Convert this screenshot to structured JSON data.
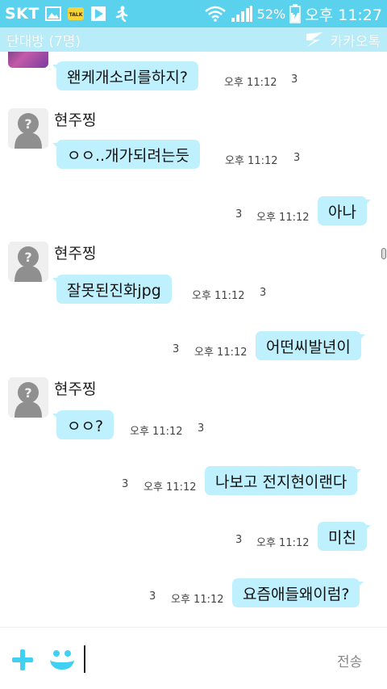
{
  "status_bar": {
    "carrier": "SKT",
    "battery": "52%",
    "time": "오후 11:27",
    "icons": [
      "gallery-icon",
      "kakaotalk-notification-icon",
      "play-store-icon",
      "running-man-icon",
      "wifi-icon",
      "signal-icon",
      "battery-icon"
    ]
  },
  "header": {
    "title": "단대방 (7명)",
    "brand": "카카오톡"
  },
  "messages": [
    {
      "side": "in",
      "sender": "",
      "text": "왠케개소리를하지?",
      "time": "오후 11:12",
      "unread": "3"
    },
    {
      "side": "in",
      "sender": "현주찡",
      "text": "ㅇㅇ..개가되려는듯",
      "time": "오후 11:12",
      "unread": "3"
    },
    {
      "side": "out",
      "text": "아나",
      "time": "오후 11:12",
      "unread": "3"
    },
    {
      "side": "in",
      "sender": "현주찡",
      "text": "잘못된진화jpg",
      "time": "오후 11:12",
      "unread": "3"
    },
    {
      "side": "out",
      "text": "어떤씨발년이",
      "time": "오후 11:12",
      "unread": "3"
    },
    {
      "side": "in",
      "sender": "현주찡",
      "text": "ㅇㅇ?",
      "time": "오후 11:12",
      "unread": "3"
    },
    {
      "side": "out",
      "text": "나보고 전지현이랜다",
      "time": "오후 11:12",
      "unread": "3"
    },
    {
      "side": "out",
      "text": "미친",
      "time": "오후 11:12",
      "unread": "3"
    },
    {
      "side": "out",
      "text": "요즘애들왜이럼?",
      "time": "오후 11:12",
      "unread": "3"
    }
  ],
  "input": {
    "value": "",
    "send_label": "전송"
  },
  "colors": {
    "status_bar": "#5ad2ee",
    "title_bar": "#b8ecf8",
    "bubble": "#bff0fd",
    "accent": "#3fd0f2"
  }
}
